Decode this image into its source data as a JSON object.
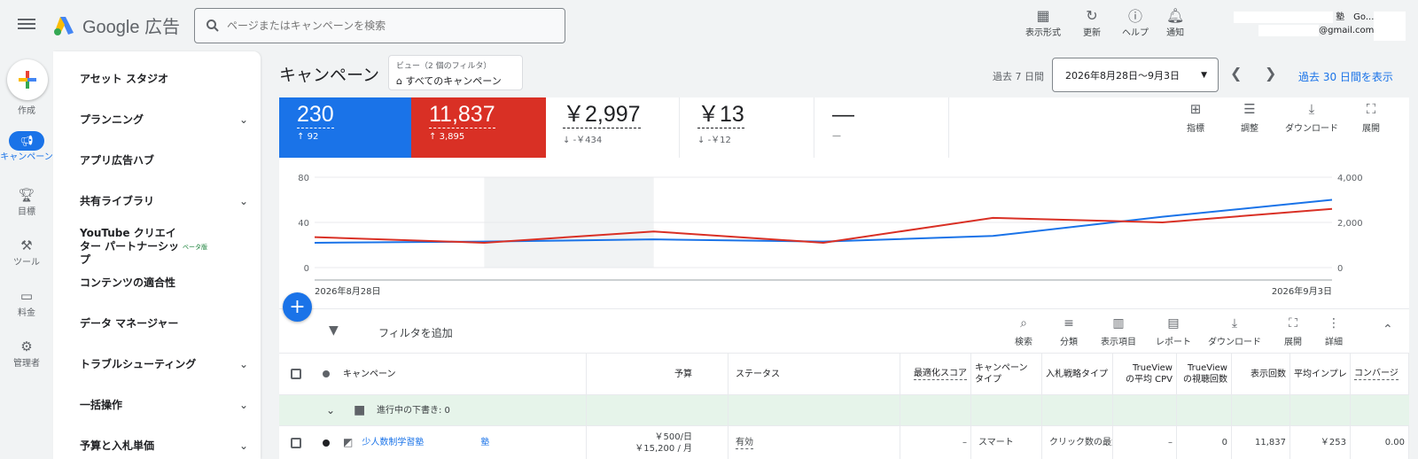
{
  "header": {
    "app_name": "Google 広告",
    "search_placeholder": "ページまたはキャンペーンを検索",
    "actions": [
      {
        "label": "表示形式",
        "icon": "appearance-icon"
      },
      {
        "label": "更新",
        "icon": "refresh-icon"
      },
      {
        "label": "ヘルプ",
        "icon": "help-icon"
      },
      {
        "label": "通知",
        "icon": "bell-icon"
      }
    ],
    "account_name_suffix": "塾　Go...",
    "account_email_suffix": "@gmail.com"
  },
  "rail": {
    "create": "作成",
    "items": [
      {
        "label": "キャンペーン",
        "icon": "megaphone-icon"
      },
      {
        "label": "目標",
        "icon": "trophy-icon"
      },
      {
        "label": "ツール",
        "icon": "tools-icon"
      },
      {
        "label": "料金",
        "icon": "card-icon"
      },
      {
        "label": "管理者",
        "icon": "gear-icon"
      }
    ]
  },
  "sidebar": {
    "items": [
      {
        "label": "アセット スタジオ",
        "expandable": false
      },
      {
        "label": "プランニング",
        "expandable": true
      },
      {
        "label": "アプリ広告ハブ",
        "expandable": false
      },
      {
        "label": "共有ライブラリ",
        "expandable": true
      },
      {
        "label": "YouTube クリエイター パートナーシップ",
        "badge": "ベータ版",
        "expandable": false
      },
      {
        "label": "コンテンツの適合性",
        "expandable": false
      },
      {
        "label": "データ マネージャー",
        "expandable": false
      },
      {
        "label": "トラブルシューティング",
        "expandable": true
      },
      {
        "label": "一括操作",
        "expandable": true
      },
      {
        "label": "予算と入札単価",
        "expandable": true
      }
    ]
  },
  "main": {
    "title": "キャンペーン",
    "view_chip": {
      "top": "ビュー（2 個のフィルタ）",
      "main": "すべてのキャンペーン"
    },
    "date_preset": "過去 7 日間",
    "date_range": "2026年8月28日〜9月3日",
    "show_30": "過去 30 日間を表示"
  },
  "metrics": [
    {
      "value": "230",
      "delta": "92",
      "dir": "up",
      "color": "#1a73e8"
    },
    {
      "value": "11,837",
      "delta": "3,895",
      "dir": "up",
      "color": "#d93025"
    },
    {
      "value": "￥2,997",
      "delta": "-￥434",
      "dir": "down"
    },
    {
      "value": "￥13",
      "delta": "-￥12",
      "dir": "down"
    },
    {
      "value": "—",
      "delta": "—",
      "dir": "none"
    }
  ],
  "card_tools": [
    {
      "label": "指標",
      "icon": "add-chart-icon"
    },
    {
      "label": "調整",
      "icon": "tune-icon"
    },
    {
      "label": "ダウンロード",
      "icon": "download-icon"
    },
    {
      "label": "展開",
      "icon": "fullscreen-icon"
    }
  ],
  "chart_data": {
    "type": "line",
    "x": [
      "2026年8月28日",
      "",
      "",
      "",
      "",
      "",
      "2026年9月3日"
    ],
    "x_tick_labels": {
      "first": "2026年8月28日",
      "last": "2026年9月3日"
    },
    "series": [
      {
        "axis": "left",
        "color": "#1a73e8",
        "values": [
          22,
          23,
          25,
          23,
          28,
          45,
          60
        ]
      },
      {
        "axis": "right",
        "color": "#d93025",
        "values": [
          1350,
          1100,
          1600,
          1100,
          2200,
          2000,
          2600
        ]
      }
    ],
    "y_left": {
      "ticks": [
        "80",
        "40",
        "0"
      ],
      "range": [
        0,
        80
      ]
    },
    "y_right": {
      "ticks": [
        "4,000",
        "2,000",
        "0"
      ],
      "range": [
        0,
        4000
      ]
    },
    "highlight_range": [
      1,
      2
    ]
  },
  "filterbar": {
    "add_filter": "フィルタを追加",
    "tools": [
      {
        "label": "検索",
        "icon": "search-icon"
      },
      {
        "label": "分類",
        "icon": "segment-icon"
      },
      {
        "label": "表示項目",
        "icon": "columns-icon"
      },
      {
        "label": "レポート",
        "icon": "report-icon"
      },
      {
        "label": "ダウンロード",
        "icon": "download-icon"
      },
      {
        "label": "展開",
        "icon": "fullscreen-icon"
      },
      {
        "label": "詳細",
        "icon": "more-icon"
      }
    ]
  },
  "table": {
    "headers": {
      "campaign": "キャンペーン",
      "budget": "予算",
      "status": "ステータス",
      "opt_score": "最適化スコア",
      "campaign_type": "キャンペーン タイプ",
      "bid_strategy": "入札戦略タイプ",
      "avg_cpv": "TrueView の平均 CPV",
      "views": "TrueView の視聴回数",
      "impressions": "表示回数",
      "avg_imp": "平均インプレ",
      "conversions": "コンバージ"
    },
    "group_row": "進行中の下書き: 0",
    "rows": [
      {
        "campaign": "少人数制学習塾",
        "campaign_suffix": "塾",
        "budget_daily": "￥500/日",
        "budget_monthly": "￥15,200 / 月",
        "status": "有効",
        "opt_score": "–",
        "campaign_type": "スマート",
        "bid_strategy": "クリック数の最大",
        "avg_cpv": "–",
        "views": "0",
        "impressions": "11,837",
        "avg_imp": "￥253",
        "conversions": "0.00"
      }
    ]
  }
}
